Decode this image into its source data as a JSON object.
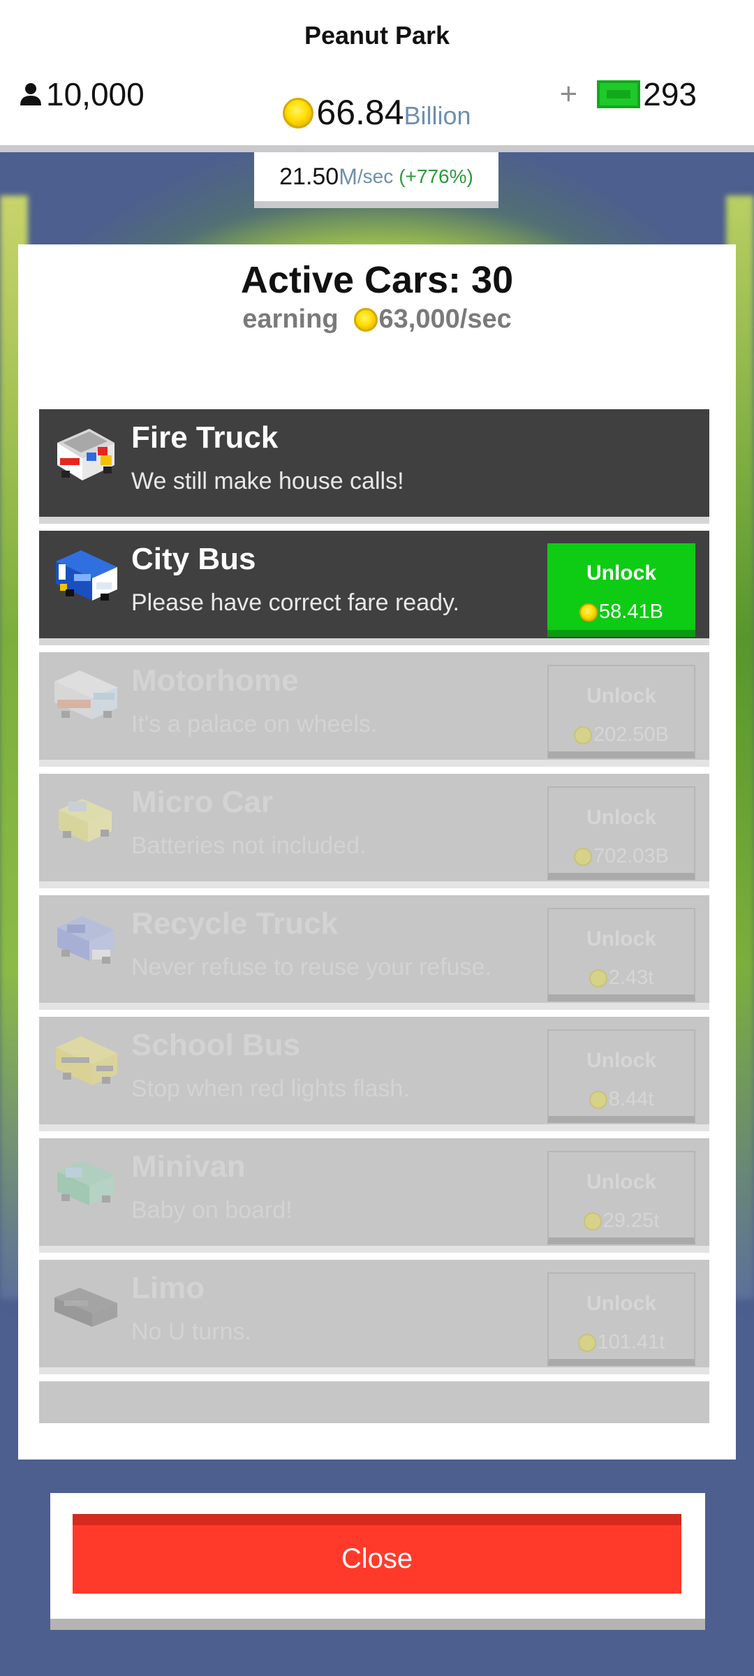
{
  "header": {
    "park_name": "Peanut Park",
    "visitors": "10,000",
    "money_value": "66.84",
    "money_unit": "Billion",
    "cash": "293",
    "icons": {
      "visitors": "person-icon",
      "money": "coin-icon",
      "add": "plus-icon",
      "cash": "bill-icon"
    }
  },
  "rate": {
    "value": "21.50",
    "unit": "M",
    "per": "/sec",
    "boost": "(+776%)"
  },
  "panel": {
    "title": "Active Cars: 30",
    "earning_label": "earning",
    "earning_value": "63,000/sec"
  },
  "cars": [
    {
      "name": "Fire Truck",
      "desc": "We still make house calls!",
      "state": "owned",
      "icon": "fire-truck-icon"
    },
    {
      "name": "City Bus",
      "desc": "Please have correct fare ready.",
      "state": "available",
      "unlock_label": "Unlock",
      "price": "58.41B",
      "icon": "city-bus-icon"
    },
    {
      "name": "Motorhome",
      "desc": "It's a palace on wheels.",
      "state": "locked",
      "unlock_label": "Unlock",
      "price": "202.50B",
      "icon": "motorhome-icon"
    },
    {
      "name": "Micro Car",
      "desc": "Batteries not included.",
      "state": "locked",
      "unlock_label": "Unlock",
      "price": "702.03B",
      "icon": "micro-car-icon"
    },
    {
      "name": "Recycle Truck",
      "desc": "Never refuse to reuse your refuse.",
      "state": "locked",
      "unlock_label": "Unlock",
      "price": "2.43t",
      "icon": "recycle-truck-icon"
    },
    {
      "name": "School Bus",
      "desc": "Stop when red lights flash.",
      "state": "locked",
      "unlock_label": "Unlock",
      "price": "8.44t",
      "icon": "school-bus-icon"
    },
    {
      "name": "Minivan",
      "desc": "Baby on board!",
      "state": "locked",
      "unlock_label": "Unlock",
      "price": "29.25t",
      "icon": "minivan-icon"
    },
    {
      "name": "Limo",
      "desc": "No U turns.",
      "state": "locked",
      "unlock_label": "Unlock",
      "price": "101.41t",
      "icon": "limo-icon"
    }
  ],
  "close_label": "Close"
}
